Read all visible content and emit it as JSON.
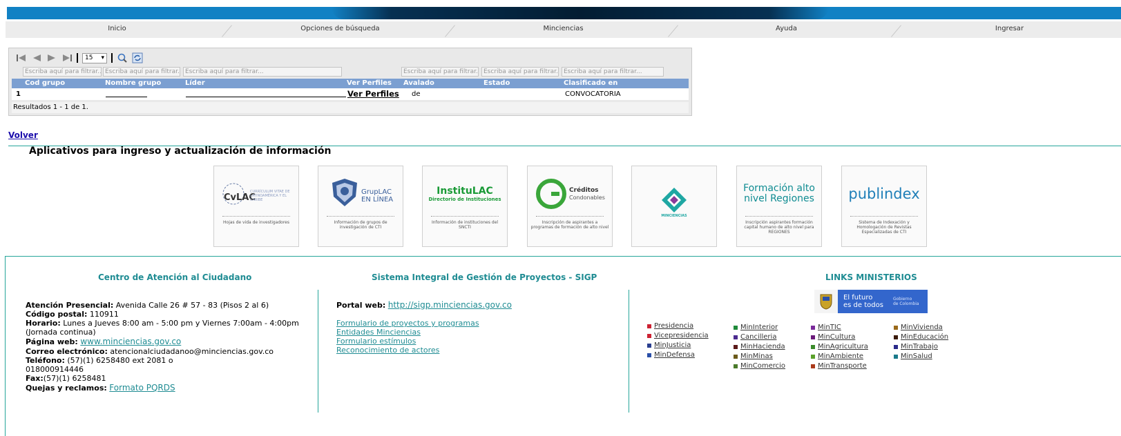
{
  "nav": {
    "items": [
      "Inicio",
      "Opciones de búsqueda",
      "Minciencias",
      "Ayuda",
      "Ingresar"
    ]
  },
  "grid": {
    "page_size": "15",
    "filter_placeholder": "Escriba aquí para filtrar...",
    "columns": [
      "Cod grupo",
      "Nombre grupo",
      "Líder",
      "Ver Perfiles",
      "Avalado",
      "Estado",
      "Clasificado en"
    ],
    "row": {
      "cod": "1",
      "ver_perfiles": "Ver Perfiles",
      "avalado": "de",
      "clasificado": "CONVOCATORIA"
    },
    "results": "Resultados 1 - 1 de 1."
  },
  "volver": "Volver",
  "apps": {
    "title": "Aplicativos para ingreso y actualización de información",
    "tiles": [
      {
        "name": "CvLAC",
        "sub": "CURRÍCULUM VITAE DE LATINOAMÉRICA Y EL CARIBE",
        "caption": "Hojas de vida de investigadores",
        "color": "#5a6e9a"
      },
      {
        "name": "GrupLAC EN LÍNEA",
        "sub": "",
        "caption": "Información de grupos de investigación de CTI",
        "color": "#3a5f9b"
      },
      {
        "name": "InstituLAC",
        "sub": "Directorio de Instituciones",
        "caption": "Información de instituciones del SNCTI",
        "color": "#1a9a37"
      },
      {
        "name": "Créditos",
        "sub": "Condonables",
        "caption": "Inscripción de aspirantes a programas de formación de alto nivel",
        "color": "#3aa63a"
      },
      {
        "name": "MINCIENCIAS",
        "sub": "",
        "caption": "",
        "color": "#1fa7a3"
      },
      {
        "name": "Formación alto nivel Regiones",
        "sub": "",
        "caption": "Inscripción aspirantes formación capital humano de alto nivel para REGIONES",
        "color": "#0f8c92"
      },
      {
        "name": "publindex",
        "sub": "",
        "caption": "Sistema de Indexación y Homologación de Revistas Especializadas de CTI",
        "color": "#1f7fb8"
      }
    ]
  },
  "footer": {
    "centro": {
      "title": "Centro de Atención al Ciudadano",
      "presencial_label": "Atención Presencial:",
      "presencial": "Avenida Calle 26 # 57 - 83 (Pisos 2 al 6)",
      "postal_label": "Código postal:",
      "postal": "110911",
      "horario_label": "Horario:",
      "horario": "Lunes a Jueves 8:00 am - 5:00 pm y Viernes 7:00am - 4:00pm",
      "horario2": "(Jornada continua)",
      "web_label": "Página web:",
      "web": "www.minciencias.gov.co",
      "correo_label": "Correo electrónico:",
      "correo": "atencionalciudadanoo@minciencias.gov.co",
      "tel_label": "Teléfono:",
      "tel": "(57)(1) 6258480 ext 2081 o",
      "tel2": "018000914446",
      "fax_label": "Fax:",
      "fax": "(57)(1) 6258481",
      "quejas_label": "Quejas y reclamos:",
      "quejas": "Formato PQRDS"
    },
    "sigp": {
      "title": "Sistema Integral de Gestión de Proyectos - SIGP",
      "portal_label": "Portal web:",
      "portal": "http://sigp.minciencias.gov.co",
      "links": [
        "Formulario de proyectos y programas",
        "Entidades Minciencias",
        "Formulario estímulos",
        "Reconocimiento de actores"
      ]
    },
    "links": {
      "title": "LINKS MINISTERIOS",
      "badge_line1": "El futuro",
      "badge_line2": "es de todos",
      "badge_gov1": "Gobierno",
      "badge_gov2": "de Colombia",
      "col1": [
        {
          "label": "Presidencia",
          "color": "#cc2233"
        },
        {
          "label": "Vicepresidencia",
          "color": "#cc2233"
        },
        {
          "label": "MinJusticia",
          "color": "#2a3f8f"
        },
        {
          "label": "MinDefensa",
          "color": "#2a4fa8"
        }
      ],
      "col2": [
        {
          "label": "MinInterior",
          "color": "#1f8a3a"
        },
        {
          "label": "Cancilleria",
          "color": "#4b2a8f"
        },
        {
          "label": "MinHacienda",
          "color": "#5a1a1a"
        },
        {
          "label": "MinMinas",
          "color": "#6b5a1a"
        },
        {
          "label": "MinComercio",
          "color": "#4a7a2a"
        }
      ],
      "col3": [
        {
          "label": "MinTIC",
          "color": "#7a2a9a"
        },
        {
          "label": "MinCultura",
          "color": "#6a1a7a"
        },
        {
          "label": "MinAgricultura",
          "color": "#3a8a2a"
        },
        {
          "label": "MinAmbiente",
          "color": "#5aa02a"
        },
        {
          "label": "MinTransporte",
          "color": "#aa3a1a"
        }
      ],
      "col4": [
        {
          "label": "MinVivienda",
          "color": "#9a6a1a"
        },
        {
          "label": "MinEducación",
          "color": "#3a1a0a"
        },
        {
          "label": "MinTrabajo",
          "color": "#2a2a8a"
        },
        {
          "label": "MinSalud",
          "color": "#1a7a8a"
        }
      ]
    }
  }
}
